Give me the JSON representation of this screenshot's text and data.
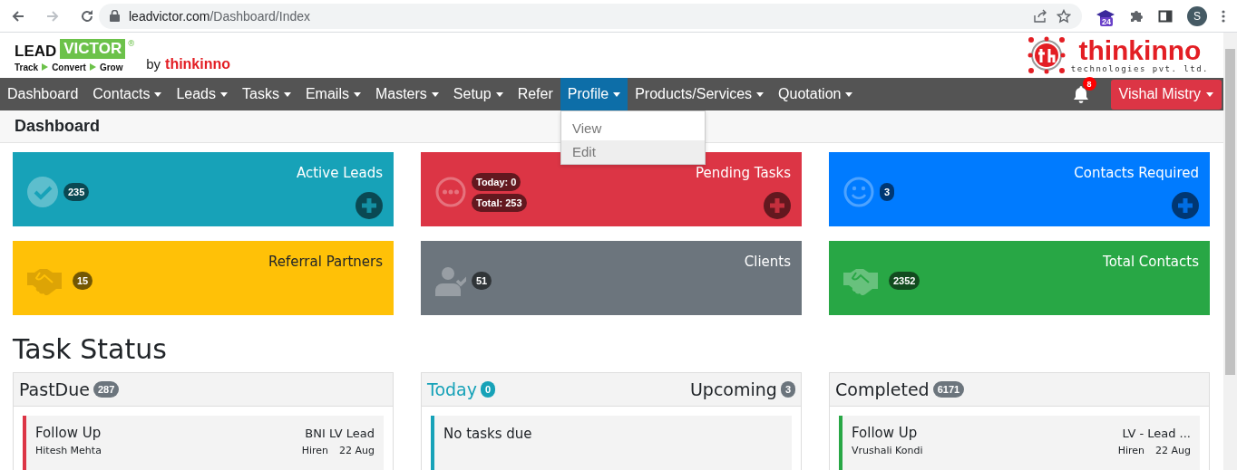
{
  "browser": {
    "url_host": "leadvictor.com",
    "url_path": "/Dashboard/Index",
    "extension_badge": "24",
    "profile_initial": "S"
  },
  "header": {
    "logo": {
      "brand_first": "LEAD",
      "brand_second": "VICTOR",
      "registered": "®",
      "tagline": [
        "Track",
        "Convert",
        "Grow"
      ],
      "by": "by",
      "by_brand": "thinkinno"
    },
    "company_logo": {
      "name": "thinkinno",
      "subtitle": "technologies pvt. ltd."
    }
  },
  "nav": {
    "items": [
      {
        "label": "Dashboard",
        "dropdown": false,
        "selected": false
      },
      {
        "label": "Contacts",
        "dropdown": true,
        "selected": false
      },
      {
        "label": "Leads",
        "dropdown": true,
        "selected": false
      },
      {
        "label": "Tasks",
        "dropdown": true,
        "selected": false
      },
      {
        "label": "Emails",
        "dropdown": true,
        "selected": false
      },
      {
        "label": "Masters",
        "dropdown": true,
        "selected": false
      },
      {
        "label": "Setup",
        "dropdown": true,
        "selected": false
      },
      {
        "label": "Refer",
        "dropdown": false,
        "selected": false
      },
      {
        "label": "Profile",
        "dropdown": true,
        "selected": true
      },
      {
        "label": "Products/Services",
        "dropdown": true,
        "selected": false
      },
      {
        "label": "Quotation",
        "dropdown": true,
        "selected": false
      }
    ],
    "notifications": {
      "count": "8"
    },
    "user": {
      "name": "Vishal Mistry"
    }
  },
  "profile_menu": {
    "items": [
      {
        "label": "View",
        "hovered": false
      },
      {
        "label": "Edit",
        "hovered": true
      }
    ]
  },
  "page_title": "Dashboard",
  "cards": [
    {
      "title": "Active Leads",
      "color": "#17a2b8",
      "badges": [
        "235"
      ],
      "add_button": true
    },
    {
      "title": "Pending Tasks",
      "color": "#dc3545",
      "badges": [
        "Today: 0",
        "Total: 253"
      ],
      "add_button": true
    },
    {
      "title": "Contacts Required",
      "color": "#007bff",
      "badges": [
        "3"
      ],
      "add_button": true
    },
    {
      "title": "Referral Partners",
      "color": "#ffc107",
      "badges": [
        "15"
      ],
      "add_button": false
    },
    {
      "title": "Clients",
      "color": "#6c757d",
      "badges": [
        "51"
      ],
      "add_button": false
    },
    {
      "title": "Total Contacts",
      "color": "#28a745",
      "badges": [
        "2352"
      ],
      "add_button": false
    }
  ],
  "task_status": {
    "title": "Task Status",
    "panels": [
      {
        "header": {
          "label": "PastDue",
          "count": "287"
        },
        "tasks": [
          {
            "title": "Follow Up",
            "contact": "Hitesh Mehta",
            "lead": "BNI LV Lead",
            "owner": "Hiren",
            "date": "22 Aug",
            "color": "#dc3545"
          }
        ]
      },
      {
        "tabs": [
          {
            "label": "Today",
            "count": "0",
            "selected": true
          },
          {
            "label": "Upcoming",
            "count": "3",
            "selected": false
          }
        ],
        "empty": {
          "message": "No tasks due",
          "color": "#17a2b8"
        }
      },
      {
        "header": {
          "label": "Completed",
          "count": "6171"
        },
        "tasks": [
          {
            "title": "Follow Up",
            "contact": "Vrushali Kondi",
            "lead": "LV - Lead ...",
            "owner": "Hiren",
            "date": "22 Aug",
            "color": "#28a745"
          }
        ]
      }
    ]
  }
}
